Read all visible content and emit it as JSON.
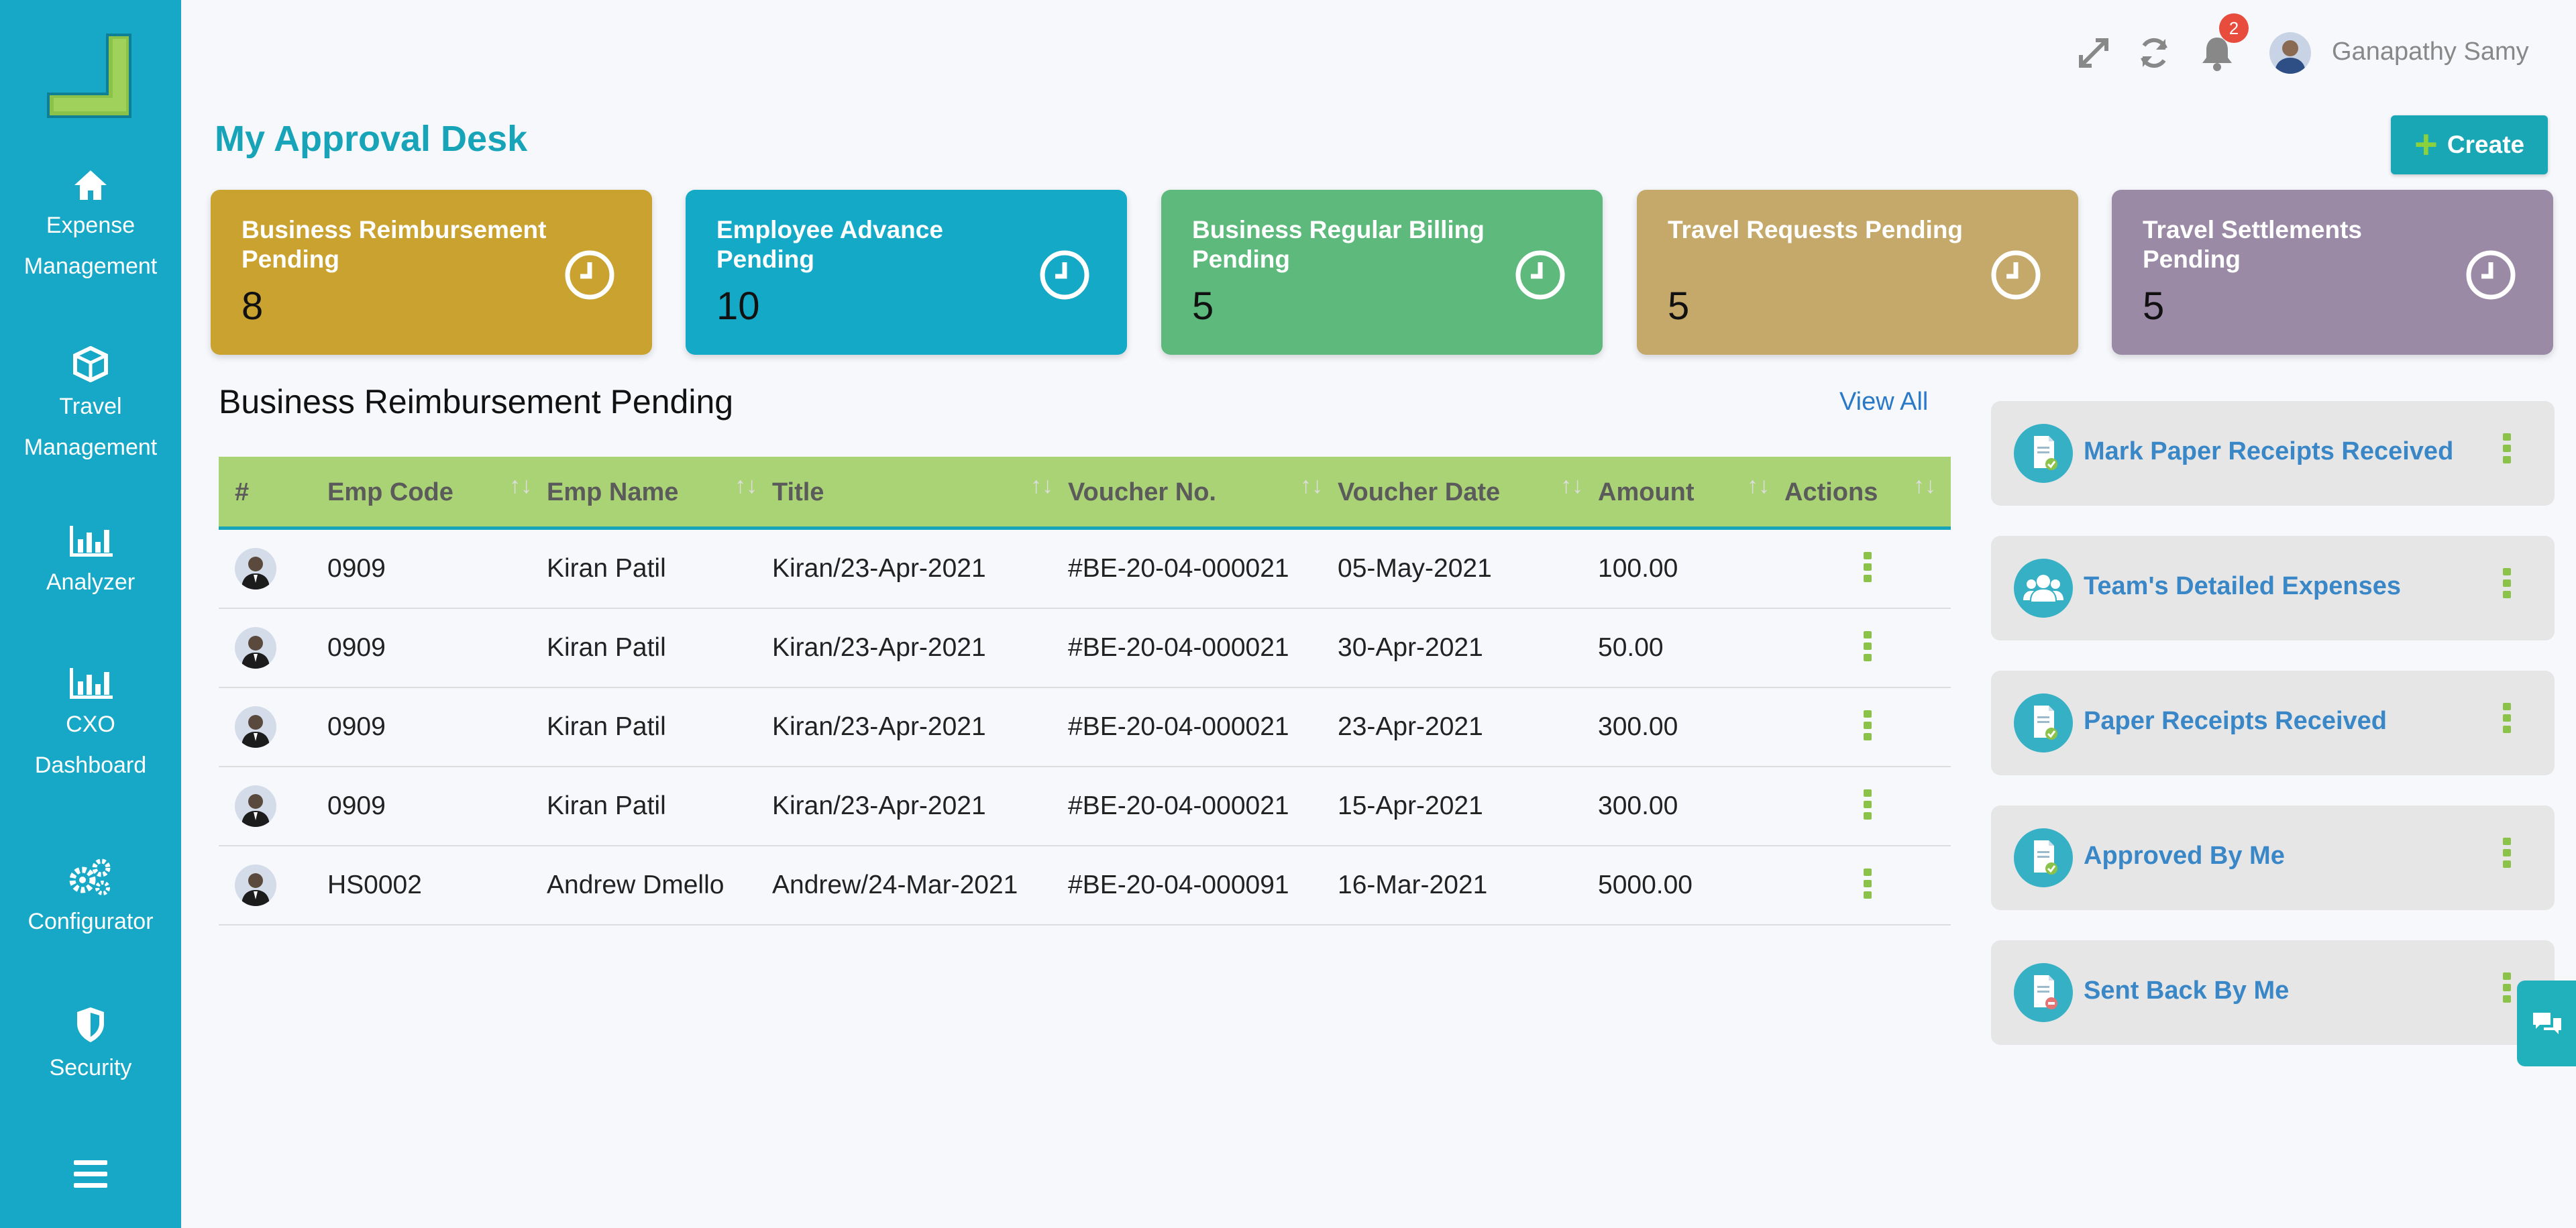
{
  "sidebar": {
    "items": [
      {
        "label_line1": "Expense",
        "label_line2": "Management",
        "icon": "home-icon"
      },
      {
        "label_line1": "Travel",
        "label_line2": "Management",
        "icon": "cube-icon"
      },
      {
        "label_line1": "Analyzer",
        "label_line2": "",
        "icon": "bar-chart-icon"
      },
      {
        "label_line1": "CXO",
        "label_line2": "Dashboard",
        "icon": "bar-chart-icon"
      },
      {
        "label_line1": "Configurator",
        "label_line2": "",
        "icon": "gears-icon"
      },
      {
        "label_line1": "Security",
        "label_line2": "",
        "icon": "shield-icon"
      }
    ]
  },
  "header": {
    "notification_count": "2",
    "user_name": "Ganapathy Samy"
  },
  "page": {
    "title": "My Approval Desk",
    "create_label": "Create"
  },
  "cards": [
    {
      "title": "Business Reimbursement Pending",
      "count": "8",
      "color": "#c9a22f"
    },
    {
      "title": "Employee Advance Pending",
      "count": "10",
      "color": "#14a9c6"
    },
    {
      "title": "Business Regular Billing Pending",
      "count": "5",
      "color": "#5dba7c"
    },
    {
      "title": "Travel Requests Pending",
      "count": "5",
      "color": "#c4a96a"
    },
    {
      "title": "Travel Settlements Pending",
      "count": "5",
      "color": "#9a8aa6"
    }
  ],
  "table": {
    "title": "Business Reimbursement Pending",
    "view_all": "View All",
    "columns": [
      "#",
      "Emp Code",
      "Emp Name",
      "Title",
      "Voucher No.",
      "Voucher Date",
      "Amount",
      "Actions"
    ],
    "rows": [
      {
        "emp_code": "0909",
        "emp_name": "Kiran Patil",
        "title": "Kiran/23-Apr-2021",
        "voucher_no": "#BE-20-04-000021",
        "voucher_date": "05-May-2021",
        "amount": "100.00"
      },
      {
        "emp_code": "0909",
        "emp_name": "Kiran Patil",
        "title": "Kiran/23-Apr-2021",
        "voucher_no": "#BE-20-04-000021",
        "voucher_date": "30-Apr-2021",
        "amount": "50.00"
      },
      {
        "emp_code": "0909",
        "emp_name": "Kiran Patil",
        "title": "Kiran/23-Apr-2021",
        "voucher_no": "#BE-20-04-000021",
        "voucher_date": "23-Apr-2021",
        "amount": "300.00"
      },
      {
        "emp_code": "0909",
        "emp_name": "Kiran Patil",
        "title": "Kiran/23-Apr-2021",
        "voucher_no": "#BE-20-04-000021",
        "voucher_date": "15-Apr-2021",
        "amount": "300.00"
      },
      {
        "emp_code": "HS0002",
        "emp_name": "Andrew Dmello",
        "title": "Andrew/24-Mar-2021",
        "voucher_no": "#BE-20-04-000091",
        "voucher_date": "16-Mar-2021",
        "amount": "5000.00"
      }
    ]
  },
  "right_panel": {
    "items": [
      {
        "label": "Mark Paper Receipts Received",
        "icon": "receipt-check-icon"
      },
      {
        "label": "Team's Detailed Expenses",
        "icon": "team-icon"
      },
      {
        "label": "Paper Receipts Received",
        "icon": "receipt-check-icon"
      },
      {
        "label": "Approved By Me",
        "icon": "receipt-check-icon"
      },
      {
        "label": "Sent Back By Me",
        "icon": "receipt-minus-icon"
      }
    ]
  }
}
